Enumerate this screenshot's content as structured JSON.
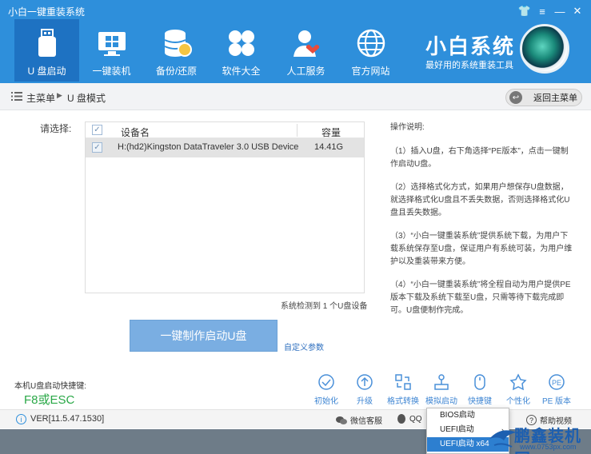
{
  "window": {
    "title": "小白一键重装系统"
  },
  "tabs": [
    {
      "label": "U 盘启动",
      "icon": "usb-drive-icon"
    },
    {
      "label": "一键装机",
      "icon": "monitor-windows-icon"
    },
    {
      "label": "备份/还原",
      "icon": "database-icon"
    },
    {
      "label": "软件大全",
      "icon": "apps-icon"
    },
    {
      "label": "人工服务",
      "icon": "user-support-icon"
    },
    {
      "label": "官方网站",
      "icon": "globe-icon"
    }
  ],
  "brand": {
    "name": "小白系统",
    "tagline": "最好用的系统重装工具"
  },
  "breadcrumb": {
    "root": "主菜单",
    "current": "U 盘模式",
    "back_label": "返回主菜单"
  },
  "device_select": {
    "label": "请选择:",
    "columns": [
      "设备名",
      "容量"
    ],
    "rows": [
      {
        "name": "H:(hd2)Kingston DataTraveler 3.0 USB Device",
        "capacity": "14.41G"
      }
    ],
    "detected_prefix": "系统检测到",
    "detected_count": "1",
    "detected_suffix": "个U盘设备"
  },
  "actions": {
    "make_button": "一键制作启动U盘",
    "custom_params": "自定义参数"
  },
  "help": {
    "title": "操作说明:",
    "steps": [
      "（1）插入U盘，右下角选择“PE版本”，点击一键制作启动U盘。",
      "（2）选择格式化方式，如果用户想保存U盘数据，就选择格式化U盘且不丢失数据，否则选择格式化U盘且丢失数据。",
      "（3）“小白一键重装系统”提供系统下载，为用户下载系统保存至U盘，保证用户有系统可装，为用户维护以及重装带来方便。",
      "（4）“小白一键重装系统”将全程自动为用户提供PE版本下载及系统下载至U盘，只需等待下载完成即可。U盘便制作完成。"
    ]
  },
  "hotkey": {
    "label": "本机U盘启动快捷键:",
    "value": "F8或ESC"
  },
  "tools": [
    {
      "label": "初始化",
      "icon": "check-circle-icon"
    },
    {
      "label": "升级",
      "icon": "upgrade-icon"
    },
    {
      "label": "格式转换",
      "icon": "convert-icon"
    },
    {
      "label": "模拟启动",
      "icon": "simulate-icon"
    },
    {
      "label": "快捷键",
      "icon": "mouse-icon"
    },
    {
      "label": "个性化",
      "icon": "personalize-icon"
    },
    {
      "label": "PE 版本",
      "icon": "pe-icon"
    }
  ],
  "status": {
    "version": "VER[11.5.47.1530]",
    "wechat": "微信客服",
    "qq": "QQ",
    "help_video": "帮助视频"
  },
  "popup_menu": {
    "items": [
      {
        "label": "BIOS启动",
        "selected": false
      },
      {
        "label": "UEFI启动",
        "selected": false,
        "sub": "›"
      },
      {
        "label": "UEFI启动 x64",
        "selected": true
      }
    ]
  },
  "watermark": {
    "text": "鹏鑫装机网",
    "url": "www.0753px.com"
  },
  "colors": {
    "header": "#2e8fdb",
    "active_tab": "#1e72c2",
    "button": "#7aaee2",
    "hotkey": "#2aa847",
    "tool": "#3f86d3"
  }
}
